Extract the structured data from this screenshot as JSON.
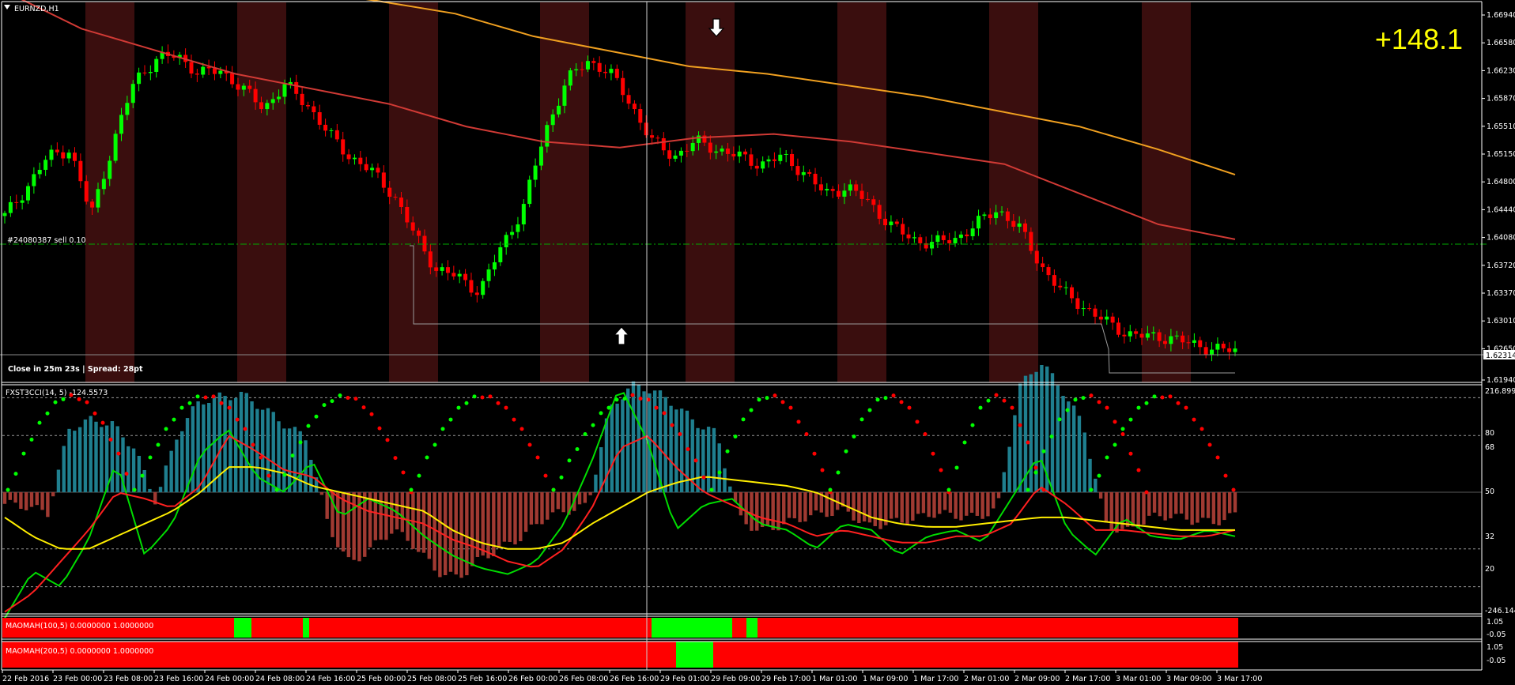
{
  "symbol_title": "EURNZD,H1",
  "profit": "+148.1",
  "order_label": "#24080387 sell 0.10",
  "status_line": "Close in 25m 23s | Spread: 28pt",
  "current_price_label": "1.62314",
  "price_axis_labels": [
    "1.66940",
    "1.66580",
    "1.66230",
    "1.65870",
    "1.65510",
    "1.65150",
    "1.64800",
    "1.64440",
    "1.64080",
    "1.63720",
    "1.63370",
    "1.63010",
    "1.62650",
    "1.61940"
  ],
  "time_axis_labels": [
    "22 Feb 2016",
    "23 Feb 00:00",
    "23 Feb 08:00",
    "23 Feb 16:00",
    "24 Feb 00:00",
    "24 Feb 08:00",
    "24 Feb 16:00",
    "25 Feb 00:00",
    "25 Feb 08:00",
    "25 Feb 16:00",
    "26 Feb 00:00",
    "26 Feb 08:00",
    "26 Feb 16:00",
    "29 Feb 01:00",
    "29 Feb 09:00",
    "29 Feb 17:00",
    "1 Mar 01:00",
    "1 Mar 09:00",
    "1 Mar 17:00",
    "2 Mar 01:00",
    "2 Mar 09:00",
    "2 Mar 17:00",
    "3 Mar 01:00",
    "3 Mar 09:00",
    "3 Mar 17:00"
  ],
  "cci_panel": {
    "title": "FXST3CCI(14, 5) -124.5573",
    "axis_labels": [
      "216.8999",
      "80",
      "68",
      "50",
      "32",
      "20",
      "-246.1442"
    ]
  },
  "maomah1": {
    "title": "MAOMAH(100,5) 0.0000000 1.0000000",
    "axis_labels": [
      "1.05",
      "-0.05"
    ]
  },
  "maomah2": {
    "title": "MAOMAH(200,5) 0.0000000 1.0000000",
    "axis_labels": [
      "1.05",
      "-0.05"
    ]
  },
  "colors": {
    "bull": "#00ff00",
    "bear": "#ff0000",
    "ma_fast": "#d03a35",
    "ma_slow": "#f0a020",
    "session": "#3a0e0e",
    "hist_pos": "#1f7f8f",
    "hist_neg": "#a03a32",
    "cci_line": "#00dd00",
    "signal_line": "#ff2020",
    "slow_line": "#ffee00",
    "profit": "#ffff00"
  },
  "chart_data": [
    {
      "type": "candlestick",
      "title": "EURNZD,H1",
      "ylim": [
        1.6194,
        1.6694
      ],
      "x_labels": [
        "22 Feb 2016",
        "23 Feb 00:00",
        "23 Feb 08:00",
        "23 Feb 16:00",
        "24 Feb 00:00",
        "24 Feb 08:00",
        "24 Feb 16:00",
        "25 Feb 00:00",
        "25 Feb 08:00",
        "25 Feb 16:00",
        "26 Feb 00:00",
        "26 Feb 08:00",
        "26 Feb 16:00",
        "29 Feb 01:00",
        "29 Feb 09:00",
        "29 Feb 17:00",
        "1 Mar 01:00",
        "1 Mar 09:00",
        "1 Mar 17:00",
        "2 Mar 01:00",
        "2 Mar 09:00",
        "2 Mar 17:00",
        "3 Mar 01:00",
        "3 Mar 09:00",
        "3 Mar 17:00"
      ],
      "close_anchors": [
        1.6411,
        1.6448,
        1.649,
        1.65,
        1.6413,
        1.6505,
        1.6591,
        1.6619,
        1.6625,
        1.66,
        1.6605,
        1.658,
        1.6555,
        1.6585,
        1.656,
        1.652,
        1.649,
        1.647,
        1.644,
        1.6385,
        1.634,
        1.633,
        1.631,
        1.637,
        1.642,
        1.652,
        1.659,
        1.6617,
        1.6603,
        1.656,
        1.651,
        1.649,
        1.651,
        1.65,
        1.649,
        1.648,
        1.649,
        1.647,
        1.644,
        1.645,
        1.643,
        1.64,
        1.638,
        1.6375,
        1.638,
        1.64,
        1.642,
        1.6395,
        1.6345,
        1.631,
        1.629,
        1.627,
        1.6255,
        1.625,
        1.625,
        1.624,
        1.6235,
        1.6231
      ],
      "order_level": 1.6378,
      "current_price": 1.62314,
      "series": [
        {
          "name": "MA fast",
          "values": [
            1.671,
            1.666,
            1.663,
            1.66,
            1.658,
            1.656,
            1.653,
            1.651,
            1.6502,
            1.6515,
            1.652,
            1.651,
            1.6495,
            1.648,
            1.644,
            1.64,
            1.638
          ]
        },
        {
          "name": "MA slow",
          "values": [
            1.672,
            1.6712,
            1.6697,
            1.668,
            1.665,
            1.663,
            1.661,
            1.66,
            1.6585,
            1.657,
            1.655,
            1.653,
            1.65,
            1.6466
          ]
        }
      ]
    },
    {
      "type": "histogram+line",
      "title": "FXST3CCI(14, 5) -124.5573",
      "ylim": [
        -246.1442,
        216.8999
      ],
      "levels": [
        80,
        68,
        50,
        32,
        20
      ],
      "series": [
        {
          "name": "CCI",
          "values": [
            10,
            25,
            20,
            35,
            60,
            30,
            40,
            62,
            70,
            55,
            50,
            60,
            42,
            48,
            44,
            36,
            30,
            26,
            24,
            28,
            40,
            60,
            84,
            66,
            38,
            46,
            48,
            40,
            38,
            32,
            40,
            38,
            30,
            36,
            38,
            34,
            48,
            62,
            38,
            30,
            42,
            36,
            35,
            38,
            36
          ]
        },
        {
          "name": "signal",
          "values": [
            12,
            18,
            28,
            38,
            50,
            48,
            45,
            52,
            68,
            63,
            57,
            55,
            48,
            44,
            42,
            40,
            35,
            32,
            28,
            26,
            32,
            45,
            64,
            68,
            58,
            50,
            46,
            42,
            40,
            36,
            38,
            36,
            34,
            34,
            36,
            36,
            40,
            52,
            46,
            38,
            38,
            37,
            36,
            36,
            38
          ]
        },
        {
          "name": "slow",
          "values": [
            42,
            36,
            32,
            32,
            36,
            40,
            44,
            50,
            58,
            58,
            56,
            52,
            50,
            48,
            46,
            44,
            38,
            34,
            32,
            32,
            34,
            40,
            45,
            50,
            53,
            55,
            54,
            53,
            52,
            50,
            46,
            42,
            40,
            39,
            39,
            40,
            41,
            42,
            42,
            41,
            40,
            39,
            38,
            38,
            38
          ]
        }
      ],
      "hist_values": [
        -10,
        -12,
        -18,
        55,
        62,
        58,
        38,
        -8,
        50,
        78,
        82,
        84,
        72,
        58,
        46,
        -30,
        -62,
        -48,
        -32,
        -46,
        -68,
        -74,
        -58,
        -48,
        -38,
        -22,
        -16,
        -12,
        70,
        92,
        88,
        76,
        60,
        50,
        -22,
        -34,
        -28,
        -22,
        -18,
        -16,
        -30,
        -26,
        -24,
        -18,
        -20,
        -22,
        -14,
        90,
        112,
        88,
        56,
        -28,
        -34,
        -22,
        -20,
        -24,
        -26,
        -20
      ]
    },
    {
      "type": "bar-state",
      "title": "MAOMAH(100,5) 0.0000000 1.0000000",
      "ylim": [
        -0.05,
        1.05
      ],
      "green_segments": [
        [
          "24 Feb 00:00",
          "24 Feb 06:00"
        ],
        [
          "24 Feb 15:00",
          "24 Feb 16:00"
        ],
        [
          "29 Feb 00:00",
          "29 Feb 08:00"
        ],
        [
          "29 Feb 12:00",
          "29 Feb 13:00"
        ]
      ]
    },
    {
      "type": "bar-state",
      "title": "MAOMAH(200,5) 0.0000000 1.0000000",
      "ylim": [
        -0.05,
        1.05
      ],
      "green_segments": [
        [
          "29 Feb 02:00",
          "29 Feb 05:00"
        ]
      ]
    }
  ]
}
